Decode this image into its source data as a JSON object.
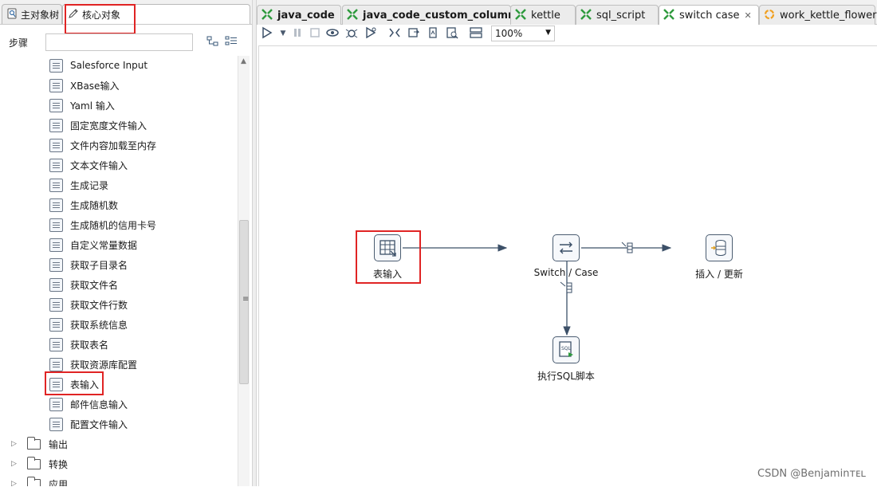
{
  "left_panel": {
    "tabs": [
      {
        "label": "主对象树",
        "icon": "tree-icon",
        "active": false
      },
      {
        "label": "核心对象",
        "icon": "pencil-icon",
        "active": true
      }
    ],
    "steps_label": "步骤",
    "search_value": "",
    "items": [
      {
        "label": "Salesforce Input",
        "icon": "salesforce-input-icon"
      },
      {
        "label": "XBase输入",
        "icon": "xbase-input-icon"
      },
      {
        "label": "Yaml 输入",
        "icon": "yaml-input-icon"
      },
      {
        "label": "固定宽度文件输入",
        "icon": "fixed-width-file-icon"
      },
      {
        "label": "文件内容加载至内存",
        "icon": "file-to-memory-icon"
      },
      {
        "label": "文本文件输入",
        "icon": "text-file-input-icon"
      },
      {
        "label": "生成记录",
        "icon": "generate-rows-icon"
      },
      {
        "label": "生成随机数",
        "icon": "random-number-icon"
      },
      {
        "label": "生成随机的信用卡号",
        "icon": "random-credit-card-icon"
      },
      {
        "label": "自定义常量数据",
        "icon": "constant-data-icon"
      },
      {
        "label": "获取子目录名",
        "icon": "subfolder-names-icon"
      },
      {
        "label": "获取文件名",
        "icon": "file-names-icon"
      },
      {
        "label": "获取文件行数",
        "icon": "file-rows-count-icon"
      },
      {
        "label": "获取系统信息",
        "icon": "system-info-icon"
      },
      {
        "label": "获取表名",
        "icon": "table-names-icon"
      },
      {
        "label": "获取资源库配置",
        "icon": "repository-config-icon"
      },
      {
        "label": "表输入",
        "icon": "table-input-icon"
      },
      {
        "label": "邮件信息输入",
        "icon": "email-input-icon"
      },
      {
        "label": "配置文件输入",
        "icon": "config-file-input-icon"
      }
    ],
    "folders": [
      {
        "label": "输出"
      },
      {
        "label": "转换"
      },
      {
        "label": "应用"
      }
    ]
  },
  "file_tabs": [
    {
      "label": "java_code",
      "bold": true,
      "icon": "transformation-icon",
      "active": false
    },
    {
      "label": "java_code_custom_column",
      "bold": true,
      "icon": "transformation-icon",
      "active": false
    },
    {
      "label": "kettle",
      "bold": false,
      "icon": "transformation-icon",
      "active": false
    },
    {
      "label": "sql_script",
      "bold": false,
      "icon": "transformation-icon",
      "active": false
    },
    {
      "label": "switch case",
      "bold": false,
      "icon": "transformation-icon",
      "active": true,
      "closable": true
    },
    {
      "label": "work_kettle_flower",
      "bold": false,
      "icon": "job-icon",
      "active": false
    }
  ],
  "toolbar": {
    "zoom": "100%"
  },
  "canvas": {
    "steps": [
      {
        "id": "table-input",
        "label": "表输入",
        "icon": "table-input-icon"
      },
      {
        "id": "switch-case",
        "label": "Switch / Case",
        "icon": "switch-icon"
      },
      {
        "id": "insert-update",
        "label": "插入 / 更新",
        "icon": "insert-update-icon"
      },
      {
        "id": "exec-sql",
        "label": "执行SQL脚本",
        "icon": "sql-script-icon"
      }
    ]
  },
  "watermark": "CSDN @Benjaminᴛᴇʟ",
  "colors": {
    "highlight_box": "#e02424",
    "hop_line": "#3c5068",
    "transformation_icon": "#2e9a3d",
    "job_icon": "#f0a020"
  }
}
